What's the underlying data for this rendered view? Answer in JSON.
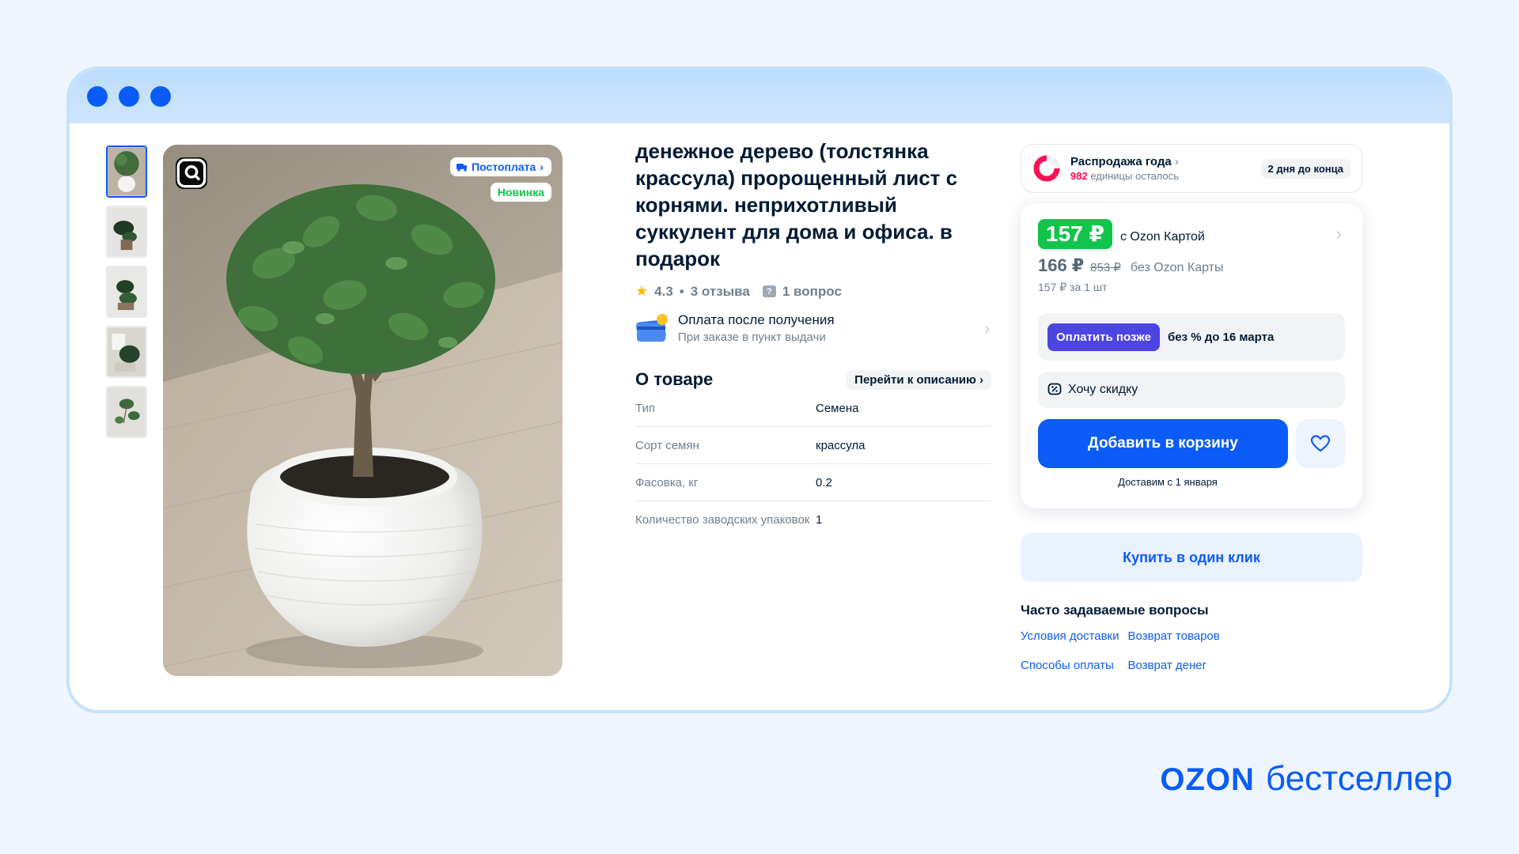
{
  "gallery": {
    "thumb_count": 5,
    "badges": {
      "postpay": "Постоплата",
      "new": "Новинка"
    }
  },
  "product": {
    "title": "денежное дерево (толстянка крассула) пророщенный лист с корнями. неприхотливый суккулент для дома и офиса. в подарок",
    "rating": "4.3",
    "reviews": "3 отзыва",
    "questions": "1 вопрос",
    "payment": {
      "title": "Оплата после получения",
      "subtitle": "При заказе в пункт выдачи"
    },
    "about": {
      "title": "О товаре",
      "go_to_description": "Перейти к описанию",
      "specs": [
        {
          "key": "Тип",
          "value": "Семена"
        },
        {
          "key": "Сорт семян",
          "value": "крассула"
        },
        {
          "key": "Фасовка, кг",
          "value": "0.2"
        },
        {
          "key": "Количество заводских упаковок",
          "value": "1"
        }
      ]
    }
  },
  "sale": {
    "title": "Распродажа года",
    "count": "982",
    "count_suffix": "единицы осталось",
    "days": "2 дня до конца"
  },
  "price": {
    "ozon_card_price": "157 ₽",
    "ozon_card_label": "с Ozon Картой",
    "regular_price": "166 ₽",
    "old_price": "853 ₽",
    "no_card_label": "без Ozon Карты",
    "unit_price": "157 ₽ за 1 шт",
    "pay_later_button": "Оплатить позже",
    "pay_later_text": "без % до 16 марта",
    "want_discount": "Хочу скидку",
    "add_to_cart": "Добавить в корзину",
    "delivery": "Доставим с 1 января"
  },
  "one_click": "Купить в один клик",
  "faq": {
    "title": "Часто задаваемые вопросы",
    "links": [
      "Условия доставки",
      "Возврат товаров",
      "Способы оплаты",
      "Возврат денег"
    ]
  },
  "brand": {
    "ozon": "OZON",
    "bestseller": "бестселлер"
  },
  "colors": {
    "accent": "#0b5cf6",
    "green_price": "#10c44c",
    "pay_later": "#4c45e0",
    "sale_count": "#f91155"
  }
}
